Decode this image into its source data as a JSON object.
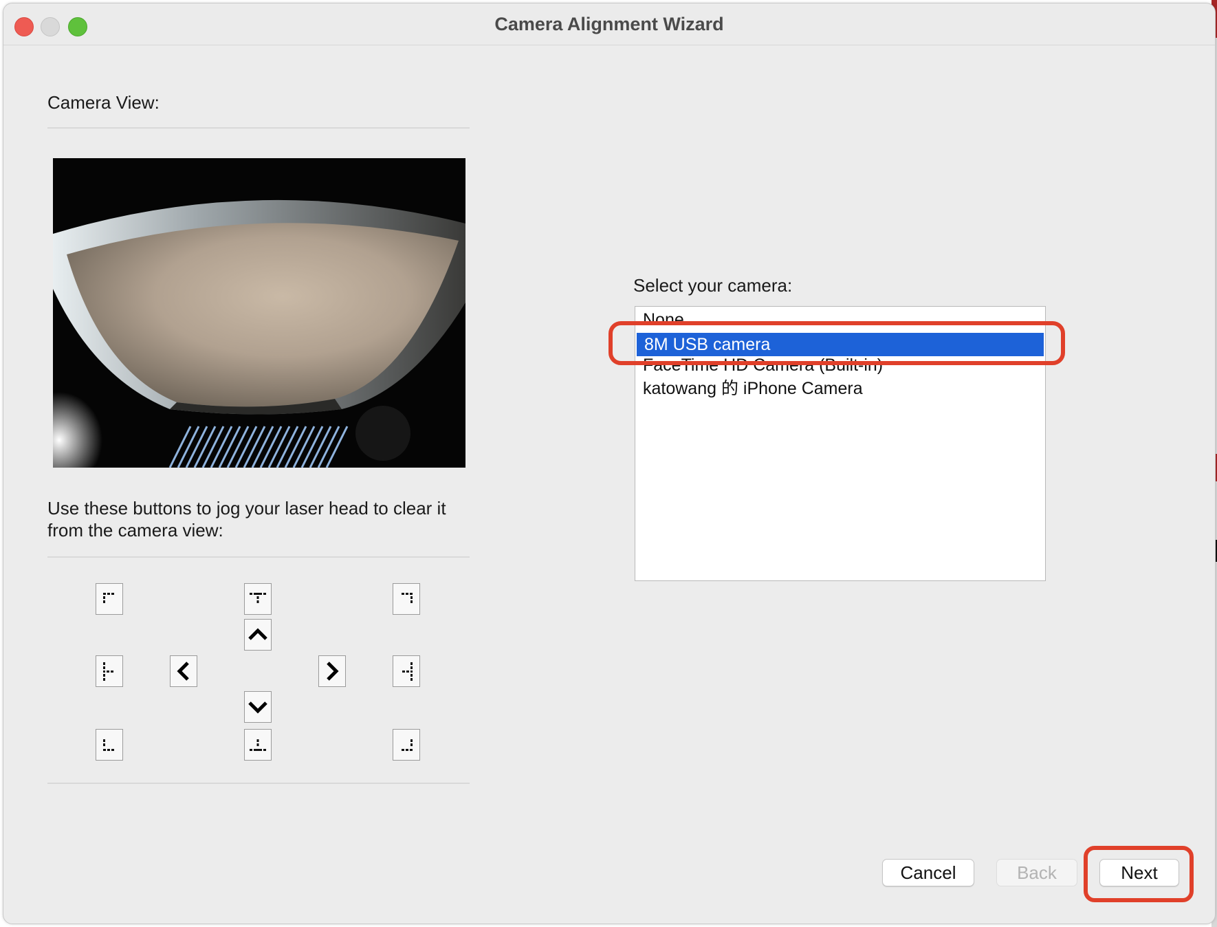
{
  "window": {
    "title": "Camera Alignment Wizard"
  },
  "left_panel": {
    "camera_view_label": "Camera View:",
    "jog_instructions": "Use these buttons to jog your laser head to clear it from the camera view:",
    "jog_buttons": [
      "top-left",
      "top-center",
      "top-right",
      "up",
      "left",
      "right",
      "middle-left",
      "middle-right",
      "down",
      "bottom-left",
      "bottom-center",
      "bottom-right"
    ]
  },
  "right_panel": {
    "select_label": "Select your camera:",
    "cameras": [
      "None",
      "8M USB camera",
      "FaceTime HD Camera (Built-in)",
      "katowang 的 iPhone Camera"
    ],
    "selected": "8M USB camera"
  },
  "footer": {
    "cancel_label": "Cancel",
    "back_label": "Back",
    "next_label": "Next"
  },
  "colors": {
    "selection": "#1d62d8",
    "highlight": "#e0402a",
    "window_bg": "#ececec"
  }
}
